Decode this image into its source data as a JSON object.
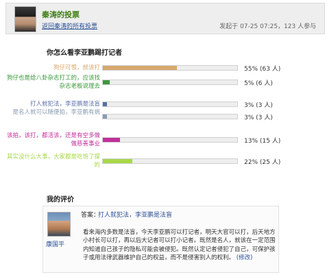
{
  "header": {
    "owner_title": "秦涛的投票",
    "back_link": "返回秦涛的所有投票",
    "meta": "发起于 07-25 07:25，123 人参与"
  },
  "poll": {
    "question": "你怎么看李亚鹏踢打记者",
    "options": [
      {
        "label": "狗仔可恨，就该打",
        "percent": 55,
        "stat": "55% (63 人)",
        "color": "#d7a86e"
      },
      {
        "label": "狗仔也是给八卦杂志打工的，应该找杂志老板说理去",
        "percent": 5,
        "stat": "5% (6 人)",
        "color": "#3a9a3a"
      },
      {
        "label": "打人就犯法，李亚鹏是法盲",
        "percent": 3,
        "stat": "3% (3 人)",
        "color": "#5a6fa8"
      },
      {
        "label": "是名人就可以随便拍，李亚鹏有病",
        "percent": 3,
        "stat": "3% (3 人)",
        "color": "#8a9bb0"
      },
      {
        "label": "该拍，该打，都活该，还是有空多做做慈善事业",
        "percent": 13,
        "stat": "13% (15 人)",
        "color": "#c0309a"
      },
      {
        "label": "其实没什么大事，大家都是吃饱了撑的",
        "percent": 22,
        "stat": "22% (25 人)",
        "color": "#a8d84a"
      }
    ]
  },
  "evaluation": {
    "title": "我的评价",
    "answer_prefix": "答案：",
    "answer": "打人就犯法，李亚鹏是法盲",
    "user_name": "康国平",
    "comment": "看来海内多数是法盲，今天李亚鹏可以打记者，明天大官可以打，后天地方小村长可以打，再以后大记者可以打小记者。既然是名人，就该在一定范围内知道自己孩子的隐私可能会被侵犯。既然认定记者侵犯了自己，可保护孩子或用法律武器维护自己的权益，而不是侵害别人的权利。",
    "edit_link": "(修改)"
  }
}
